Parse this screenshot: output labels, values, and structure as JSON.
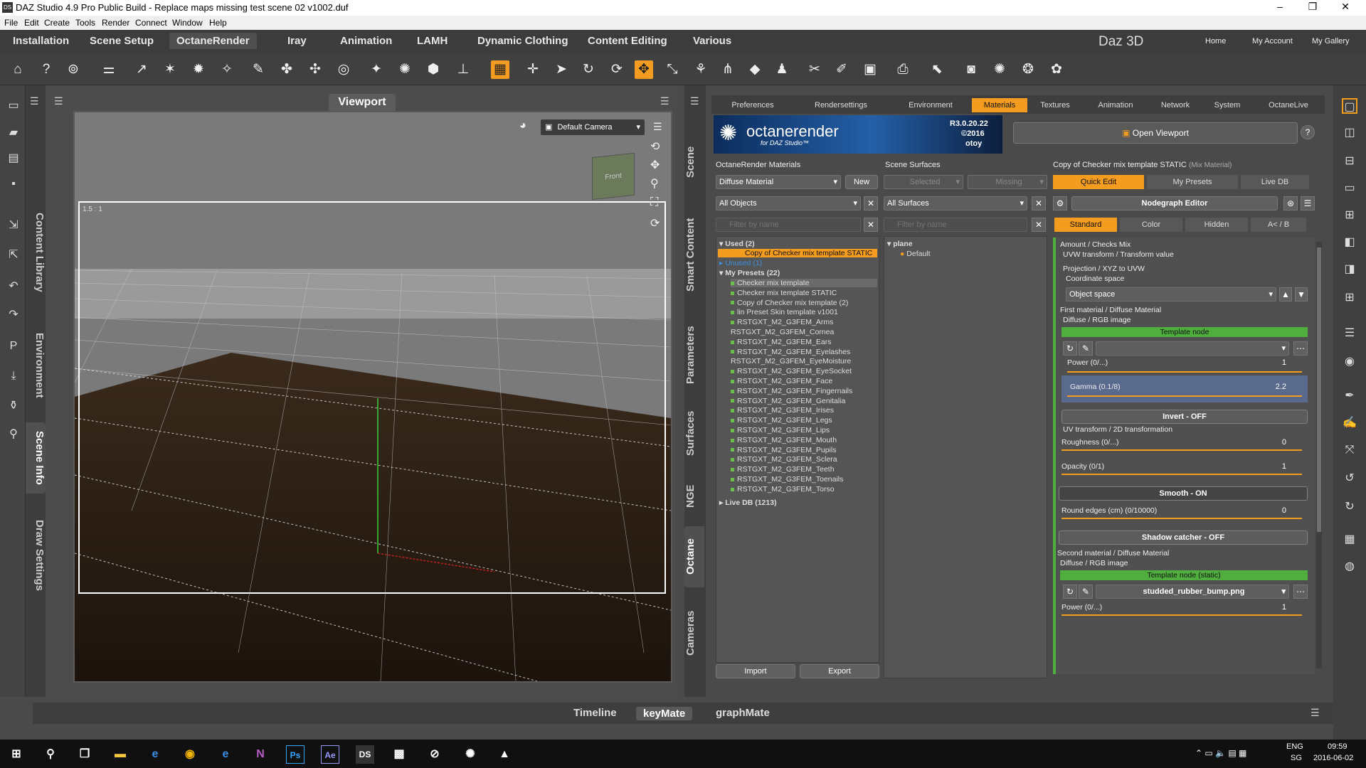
{
  "window": {
    "title": "DAZ Studio 4.9 Pro Public Build - Replace maps missing test scene 02 v1002.duf",
    "icon_label": "DS",
    "minimize": "–",
    "maximize": "❐",
    "close": "✕"
  },
  "menu": [
    "File",
    "Edit",
    "Create",
    "Tools",
    "Render",
    "Connect",
    "Window",
    "Help"
  ],
  "main_tabs": [
    "Installation",
    "Scene Setup",
    "OctaneRender",
    "Iray",
    "Animation",
    "LAMH",
    "Dynamic Clothing",
    "Content Editing",
    "Various"
  ],
  "active_main_tab": "OctaneRender",
  "header_right": {
    "brand": "Daz 3D",
    "links": [
      "Home",
      "My Account",
      "My Gallery"
    ]
  },
  "left_vtabs": [
    "Content Library",
    "Environment",
    "Scene Info",
    "Draw Settings"
  ],
  "viewport": {
    "title": "Viewport",
    "camera": "Default Camera",
    "aspect_label": "1.5 : 1",
    "cube_label": "Front"
  },
  "side_vtabs": [
    "Scene",
    "Smart Content",
    "Parameters",
    "Surfaces",
    "NGE",
    "Octane",
    "Cameras"
  ],
  "octane_tabs": [
    "Preferences",
    "Rendersettings",
    "Environment",
    "Materials",
    "Textures",
    "Animation",
    "Network",
    "System",
    "OctaneLive"
  ],
  "active_octane_tab": "Materials",
  "banner": {
    "logo": "octanerender",
    "sub": "for DAZ Studio™",
    "version": "R3.0.20.22",
    "year": "©2016",
    "company": "otoy"
  },
  "open_viewport": "Open Viewport",
  "materials_col": {
    "header": "OctaneRender Materials",
    "type_select": "Diffuse Material",
    "new_btn": "New",
    "objects_select": "All Objects",
    "filter_placeholder": "Filter by name",
    "used": "Used (2)",
    "used_item": "Copy of Checker mix template STATIC",
    "unused": "Unused (1)",
    "my_presets": "My Presets (22)",
    "presets": [
      "Checker mix template",
      "Checker mix template STATIC",
      "Copy of Checker mix template (2)",
      "lin Preset Skin template v1001",
      "RSTGXT_M2_G3FEM_Arms",
      "RSTGXT_M2_G3FEM_Cornea",
      "RSTGXT_M2_G3FEM_Ears",
      "RSTGXT_M2_G3FEM_Eyelashes",
      "RSTGXT_M2_G3FEM_EyeMoisture",
      "RSTGXT_M2_G3FEM_EyeSocket",
      "RSTGXT_M2_G3FEM_Face",
      "RSTGXT_M2_G3FEM_Fingernails",
      "RSTGXT_M2_G3FEM_Genitalia",
      "RSTGXT_M2_G3FEM_Irises",
      "RSTGXT_M2_G3FEM_Legs",
      "RSTGXT_M2_G3FEM_Lips",
      "RSTGXT_M2_G3FEM_Mouth",
      "RSTGXT_M2_G3FEM_Pupils",
      "RSTGXT_M2_G3FEM_Sclera",
      "RSTGXT_M2_G3FEM_Teeth",
      "RSTGXT_M2_G3FEM_Toenails",
      "RSTGXT_M2_G3FEM_Torso"
    ],
    "live_db": "Live DB (1213)",
    "import_btn": "Import",
    "export_btn": "Export"
  },
  "surfaces_col": {
    "header": "Scene Surfaces",
    "selected_btn": "Selected",
    "missing_btn": "Missing",
    "surfaces_select": "All Surfaces",
    "filter_placeholder": "Filter by name",
    "tree_root": "plane",
    "tree_child": "Default"
  },
  "edit_col": {
    "header": "Copy of Checker mix template STATIC",
    "header_sub": "(Mix Material)",
    "tabs": [
      "Quick Edit",
      "My Presets",
      "Live DB"
    ],
    "nodegraph_btn": "Nodegraph Editor",
    "sub_tabs": [
      "Standard",
      "Color",
      "Hidden",
      "A< / B"
    ],
    "lines": {
      "amount": "Amount / Checks Mix",
      "uvw": "UVW transform / Transform value",
      "projection": "Projection / XYZ to UVW",
      "coord_space": "Coordinate space",
      "object_space": "Object space",
      "first_mat": "First material / Diffuse Material",
      "diffuse1": "Diffuse / RGB image",
      "template_node": "Template node",
      "power": "Power (0/...)",
      "power_val": "1",
      "gamma": "Gamma (0.1/8)",
      "gamma_val": "2.2",
      "invert": "Invert - OFF",
      "uv_transform": "UV transform / 2D transformation",
      "roughness": "Roughness (0/...)",
      "roughness_val": "0",
      "opacity": "Opacity (0/1)",
      "opacity_val": "1",
      "smooth": "Smooth - ON",
      "round_edges": "Round edges (cm) (0/10000)",
      "round_val": "0",
      "shadow": "Shadow catcher - OFF",
      "second_mat": "Second material / Diffuse Material",
      "diffuse2": "Diffuse / RGB image",
      "template_static": "Template node (static)",
      "texture_file": "studded_rubber_bump.png",
      "power2": "Power (0/...)",
      "power2_val": "1"
    }
  },
  "bottom_tabs": [
    "Timeline",
    "keyMate",
    "graphMate"
  ],
  "active_bottom_tab": "keyMate",
  "taskbar": {
    "lang": "ENG",
    "region": "SG",
    "time": "09:59",
    "date": "2016-06-02"
  },
  "colors": {
    "accent": "#f39c1f",
    "green": "#4fae3e",
    "panel": "#4a4a4a"
  }
}
